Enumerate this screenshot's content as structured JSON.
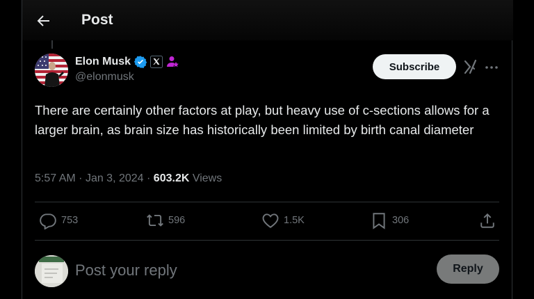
{
  "header": {
    "title": "Post"
  },
  "author": {
    "name": "Elon Musk",
    "handle": "@elonmusk"
  },
  "subscribe_label": "Subscribe",
  "post": {
    "text": "There are certainly other factors at play, but heavy use of c-sections allows for a larger brain, as brain size has historically been limited by birth canal diameter",
    "time": "5:57 AM",
    "date": "Jan 3, 2024",
    "separator": "·",
    "views_count": "603.2K",
    "views_label": "Views"
  },
  "actions": {
    "replies": "753",
    "reposts": "596",
    "likes": "1.5K",
    "bookmarks": "306"
  },
  "reply": {
    "placeholder": "Post your reply",
    "button_label": "Reply"
  },
  "colors": {
    "background": "#000000",
    "verified": "#1d9bf0",
    "affiliate": "#c026d3",
    "muted": "#71767b",
    "text": "#e7e9ea"
  },
  "icons": [
    "back-arrow-icon",
    "verified-badge-icon",
    "x-affiliate-icon",
    "subscriber-icon",
    "grok-icon",
    "more-icon",
    "reply-icon",
    "repost-icon",
    "like-icon",
    "bookmark-icon",
    "share-icon"
  ]
}
